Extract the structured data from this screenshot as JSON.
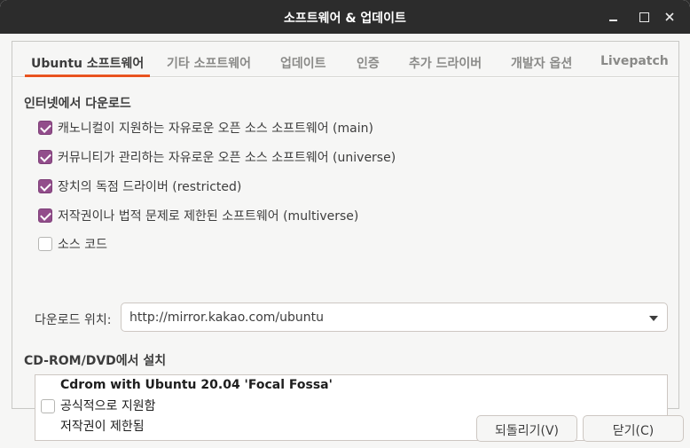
{
  "window": {
    "title": "소프트웨어 & 업데이트",
    "close_glyph": "×"
  },
  "tabs": [
    {
      "label": "Ubuntu 소프트웨어",
      "active": true
    },
    {
      "label": "기타 소프트웨어",
      "active": false
    },
    {
      "label": "업데이트",
      "active": false
    },
    {
      "label": "인증",
      "active": false
    },
    {
      "label": "추가 드라이버",
      "active": false
    },
    {
      "label": "개발자 옵션",
      "active": false
    },
    {
      "label": "Livepatch",
      "active": false
    }
  ],
  "internet": {
    "section_title": "인터넷에서 다운로드",
    "items": [
      {
        "label": "캐노니컬이 지원하는 자유로운 오픈 소스 소프트웨어 (main)",
        "checked": true
      },
      {
        "label": "커뮤니티가 관리하는 자유로운 오픈 소스 소프트웨어 (universe)",
        "checked": true
      },
      {
        "label": "장치의 독점 드라이버 (restricted)",
        "checked": true
      },
      {
        "label": "저작권이나 법적 문제로 제한된 소프트웨어 (multiverse)",
        "checked": true
      },
      {
        "label": "소스 코드",
        "checked": false
      }
    ],
    "download_label": "다운로드 위치:",
    "download_value": "http://mirror.kakao.com/ubuntu"
  },
  "cdrom": {
    "section_title": "CD-ROM/DVD에서 설치",
    "name": "Cdrom with Ubuntu 20.04 'Focal Fossa'",
    "line1": "공식적으로 지원함",
    "line2": "저작권이 제한됨",
    "checked": false
  },
  "buttons": {
    "revert": "되돌리기(V)",
    "close": "닫기(C)"
  },
  "colors": {
    "accent": "#e95420",
    "checkbox": "#924d8b",
    "titlebar": "#2c2c2c"
  }
}
